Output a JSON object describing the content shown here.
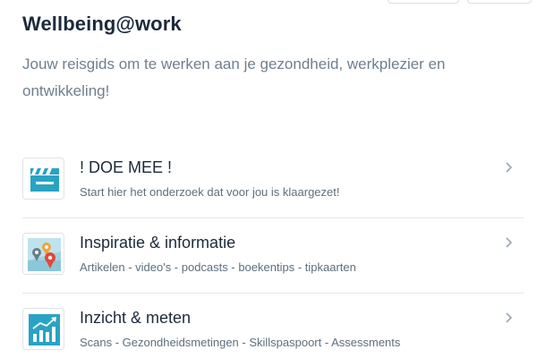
{
  "header": {
    "title": "Wellbeing@work",
    "subtitle": "Jouw reisgids om te werken aan je gezondheid, werkplezier en ontwikkeling!"
  },
  "menu": {
    "items": [
      {
        "icon": "clapperboard-icon",
        "label": "! DOE MEE !",
        "description": "Start hier het onderzoek dat voor jou is klaargezet!"
      },
      {
        "icon": "map-pin-icon",
        "label": "Inspiratie & informatie",
        "description": "Artikelen - video's - podcasts - boekentips - tipkaarten"
      },
      {
        "icon": "bar-chart-icon",
        "label": "Inzicht & meten",
        "description": "Scans - Gezondheidsmetingen - Skillspaspoort - Assessments"
      }
    ]
  },
  "colors": {
    "teal": "#29a3c4",
    "title": "#1c2a3a",
    "subtitle": "#6f7f8e",
    "divider": "#e4e7ea"
  }
}
